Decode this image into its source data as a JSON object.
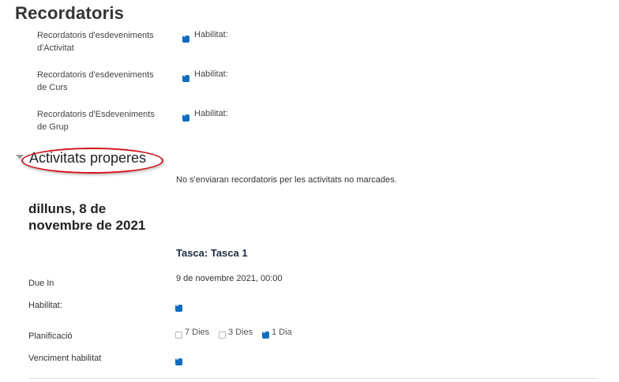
{
  "page": {
    "title": "Recordatoris"
  },
  "reminders": [
    {
      "label_line1": "Recordatoris d'esdeveniments",
      "label_line2": "d'Activitat",
      "enabled_label": "Habilitat:",
      "checked": true
    },
    {
      "label_line1": "Recordatoris d'esdeveniments",
      "label_line2": "de Curs",
      "enabled_label": "Habilitat:",
      "checked": true
    },
    {
      "label_line1": "Recordatoris d'Esdeveniments",
      "label_line2": "de Grup",
      "enabled_label": "Habilitat:",
      "checked": true
    }
  ],
  "upcoming": {
    "section_title": "Activitats properes",
    "note": "No s'enviaran recordatoris per les activitats no marcades.",
    "date_line1": "dilluns, 8 de",
    "date_line2": "novembre de 2021",
    "task_title": "Tasca: Tasca 1",
    "due_label": "Due In",
    "due_value": "9 de novembre 2021, 00:00",
    "enabled_label": "Habilitat:",
    "enabled_checked": true,
    "schedule_label": "Planificació",
    "schedule_options": [
      {
        "label": "7 Dies",
        "checked": false
      },
      {
        "label": "3 Dies",
        "checked": false
      },
      {
        "label": "1 Dia",
        "checked": true
      }
    ],
    "due_enabled_label": "Venciment habilitat",
    "due_enabled_checked": true
  },
  "colors": {
    "checkbox_accent": "#0f6cbf",
    "annotation_ellipse": "#d3141b"
  }
}
